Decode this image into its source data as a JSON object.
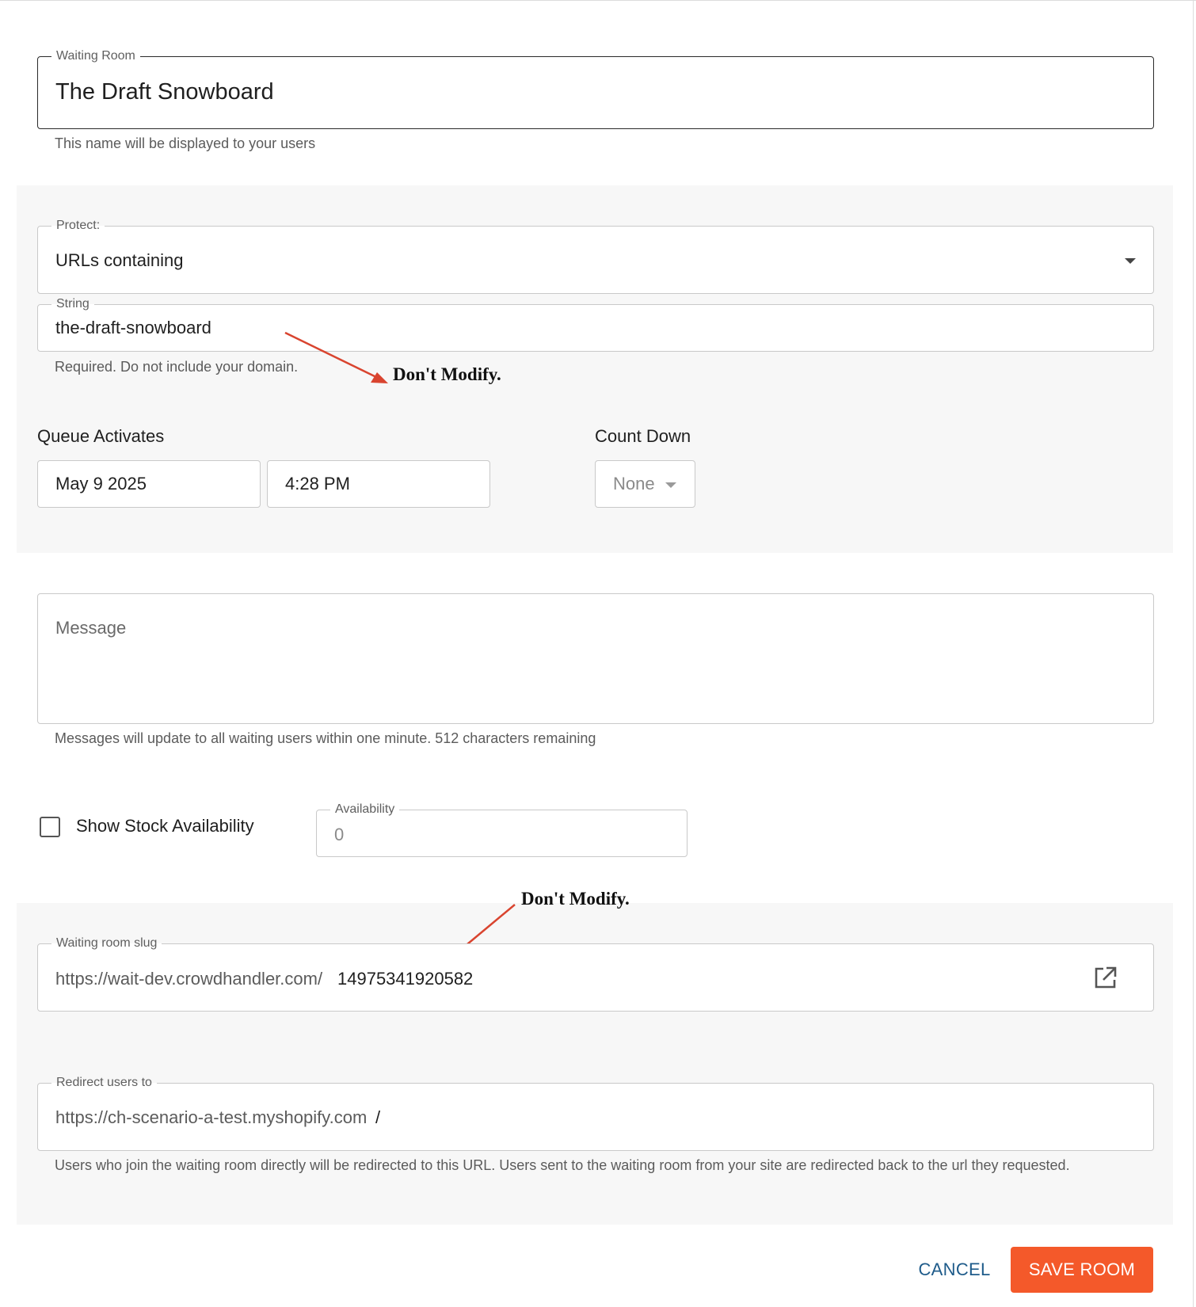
{
  "waiting_room": {
    "label": "Waiting Room",
    "value": "The Draft Snowboard",
    "helper": "This name will be displayed to your users"
  },
  "protect": {
    "label": "Protect:",
    "value": "URLs containing"
  },
  "string_field": {
    "label": "String",
    "value": "the-draft-snowboard",
    "helper": "Required. Do not include your domain."
  },
  "annotations": {
    "first": "Don't Modify.",
    "second": "Don't Modify.",
    "color": "#d9442f"
  },
  "queue": {
    "label": "Queue Activates",
    "date": "May 9 2025",
    "time": "4:28 PM"
  },
  "count_down": {
    "label": "Count Down",
    "value": "None"
  },
  "message": {
    "placeholder": "Message",
    "helper": "Messages will update to all waiting users within one minute. 512 characters remaining"
  },
  "stock": {
    "checkbox_label": "Show Stock Availability",
    "checked": false,
    "availability_label": "Availability",
    "availability_value": "0"
  },
  "slug": {
    "label": "Waiting room slug",
    "prefix": "https://wait-dev.crowdhandler.com/",
    "value": "14975341920582",
    "icon": "external-link-icon"
  },
  "redirect": {
    "label": "Redirect users to",
    "prefix": "https://ch-scenario-a-test.myshopify.com",
    "value": "/",
    "helper": "Users who join the waiting room directly will be redirected to this URL. Users sent to the waiting room from your site are redirected back to the url they requested."
  },
  "actions": {
    "cancel": "CANCEL",
    "save": "SAVE ROOM"
  },
  "colors": {
    "accent": "#f4592a",
    "link": "#1e5b8a",
    "panel": "#f7f7f7"
  }
}
